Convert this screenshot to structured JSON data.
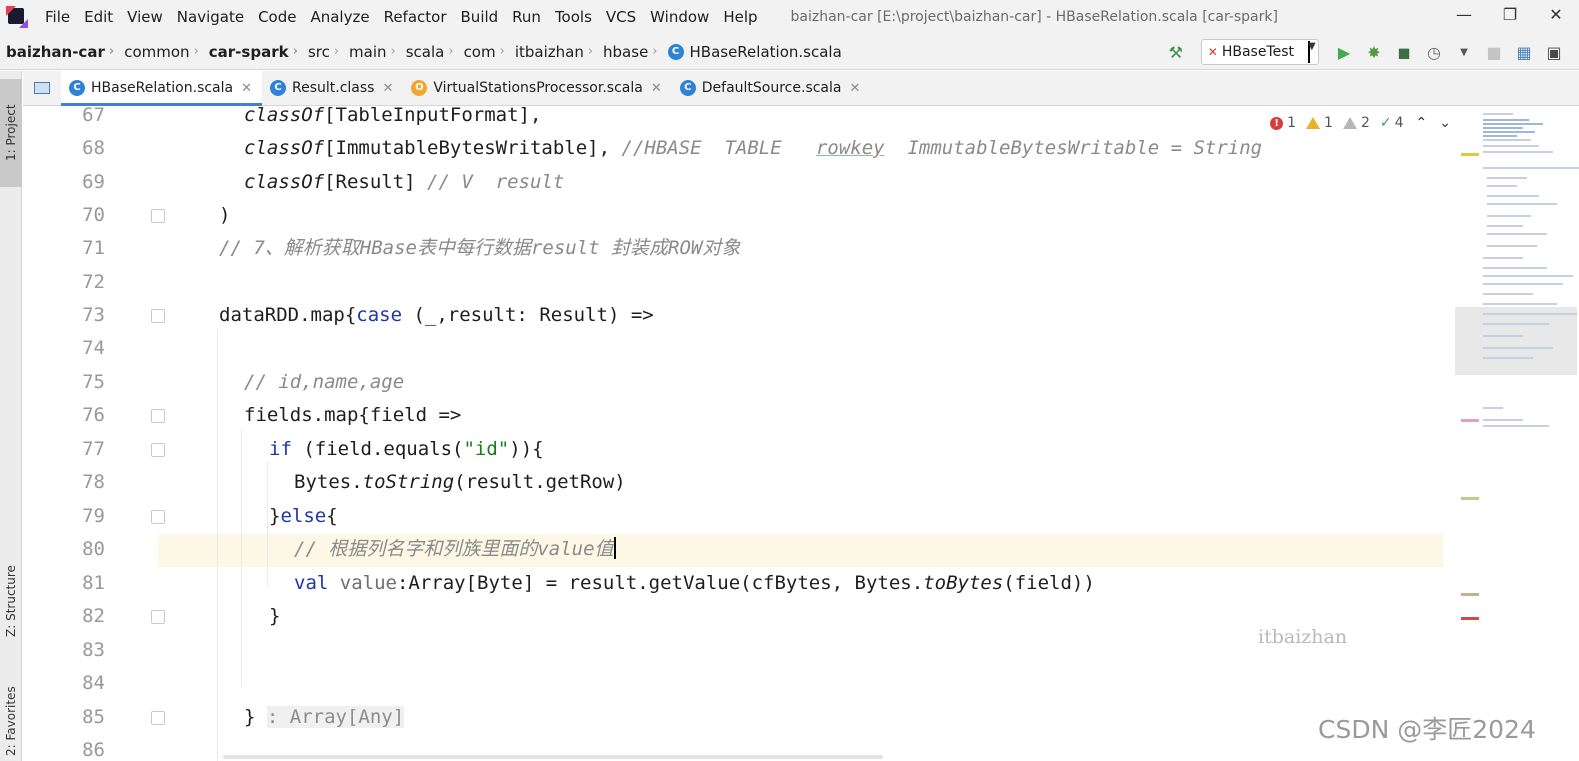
{
  "menubar": {
    "items": [
      "File",
      "Edit",
      "View",
      "Navigate",
      "Code",
      "Analyze",
      "Refactor",
      "Build",
      "Run",
      "Tools",
      "VCS",
      "Window",
      "Help"
    ],
    "window_title": "baizhan-car [E:\\project\\baizhan-car] - HBaseRelation.scala [car-spark]"
  },
  "breadcrumb": {
    "items": [
      "baizhan-car",
      "common",
      "car-spark",
      "src",
      "main",
      "scala",
      "com",
      "itbaizhan",
      "hbase"
    ],
    "file": "HBaseRelation.scala"
  },
  "toolbar": {
    "run_config": "HBaseTest"
  },
  "left_stripe": {
    "project": "1: Project",
    "structure": "Z: Structure",
    "favorites": "2: Favorites"
  },
  "tabs": [
    {
      "label": "HBaseRelation.scala",
      "icon": "scala-class-icon",
      "active": true
    },
    {
      "label": "Result.class",
      "icon": "class-icon",
      "active": false
    },
    {
      "label": "VirtualStationsProcessor.scala",
      "icon": "scala-object-icon",
      "active": false
    },
    {
      "label": "DefaultSource.scala",
      "icon": "scala-class-icon",
      "active": false
    }
  ],
  "inspections": {
    "errors": "1",
    "warnings": "1",
    "weak_warnings": "2",
    "typos": "4"
  },
  "editor": {
    "line_numbers": [
      "67",
      "68",
      "69",
      "70",
      "71",
      "72",
      "73",
      "74",
      "75",
      "76",
      "77",
      "78",
      "79",
      "80",
      "81",
      "82",
      "83",
      "84",
      "85",
      "86"
    ],
    "current_line": "80"
  },
  "watermarks": {
    "itbaizhan": "itbaizhan",
    "csdn": "CSDN @李匠2024"
  },
  "colors": {
    "keyword": "#1d36ab",
    "comment": "#8a8a8a",
    "string": "#1b7a1b",
    "current_line": "#fdf8e6",
    "tab_accent": "#4083c9"
  }
}
